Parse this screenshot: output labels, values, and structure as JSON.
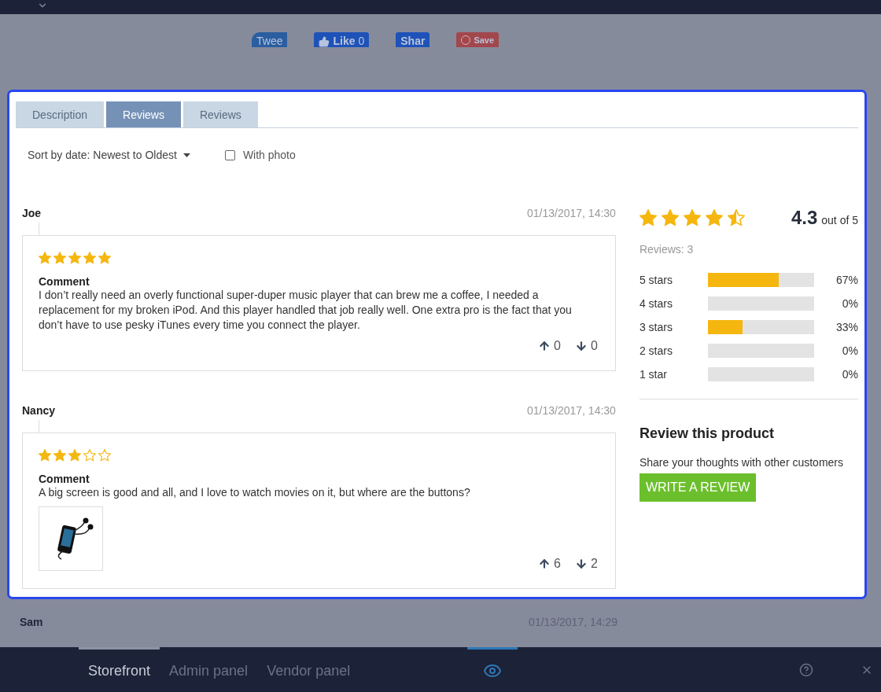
{
  "social_buttons": [
    {
      "kind": "tweet",
      "label": "Twee"
    },
    {
      "kind": "like",
      "label": "Like",
      "count": "0"
    },
    {
      "kind": "share",
      "label": "Shar"
    },
    {
      "kind": "save",
      "label": "Save"
    }
  ],
  "tabs": [
    {
      "label": "Description",
      "selected": false
    },
    {
      "label": "Reviews",
      "selected": true
    },
    {
      "label": "Reviews",
      "selected": false
    }
  ],
  "sort": {
    "label": "Sort by date: Newest to Oldest"
  },
  "with_photo": {
    "label": "With photo",
    "checked": false
  },
  "reviews": [
    {
      "author": "Joe",
      "date": "01/13/2017, 14:30",
      "stars": 5,
      "comment_title": "Comment",
      "comment": "I don’t really need an overly functional super-duper music player that can brew me a coffee, I needed a replacement for my broken iPod. And this player handled that job really well. One extra pro is the fact that you don’t have to use pesky iTunes every time you connect the player.",
      "up_votes": "0",
      "down_votes": "0"
    },
    {
      "author": "Nancy",
      "date": "01/13/2017, 14:30",
      "stars": 3,
      "comment_title": "Comment",
      "comment": "A big screen is good and all, and I love to watch movies on it, but where are the buttons?",
      "up_votes": "6",
      "down_votes": "2"
    }
  ],
  "summary": {
    "stars": 4.5,
    "score": "4.3",
    "score_suffix": "out of 5",
    "reviews_count": "Reviews: 3",
    "breakdown": [
      {
        "label": "5 stars",
        "level": 0.67,
        "percent": "67%"
      },
      {
        "label": "4 stars",
        "percent": "0%"
      },
      {
        "label": "3 stars",
        "level": 0.33,
        "percent": "33%"
      },
      {
        "label": "2 stars",
        "percent": "0%"
      },
      {
        "label": "1 star",
        "percent": "0%"
      }
    ]
  },
  "review_cta": {
    "title": "Review this product",
    "text": "Share your thoughts with other customers",
    "button": "WRITE A REVIEW"
  },
  "background_review": {
    "author": "Sam",
    "date": "01/13/2017, 14:29"
  },
  "bottom_bar": {
    "tabs": [
      {
        "label": "Storefront",
        "selected": true
      },
      {
        "label": "Admin panel",
        "selected": false
      },
      {
        "label": "Vendor panel",
        "selected": false
      }
    ],
    "preview_selected": true
  }
}
